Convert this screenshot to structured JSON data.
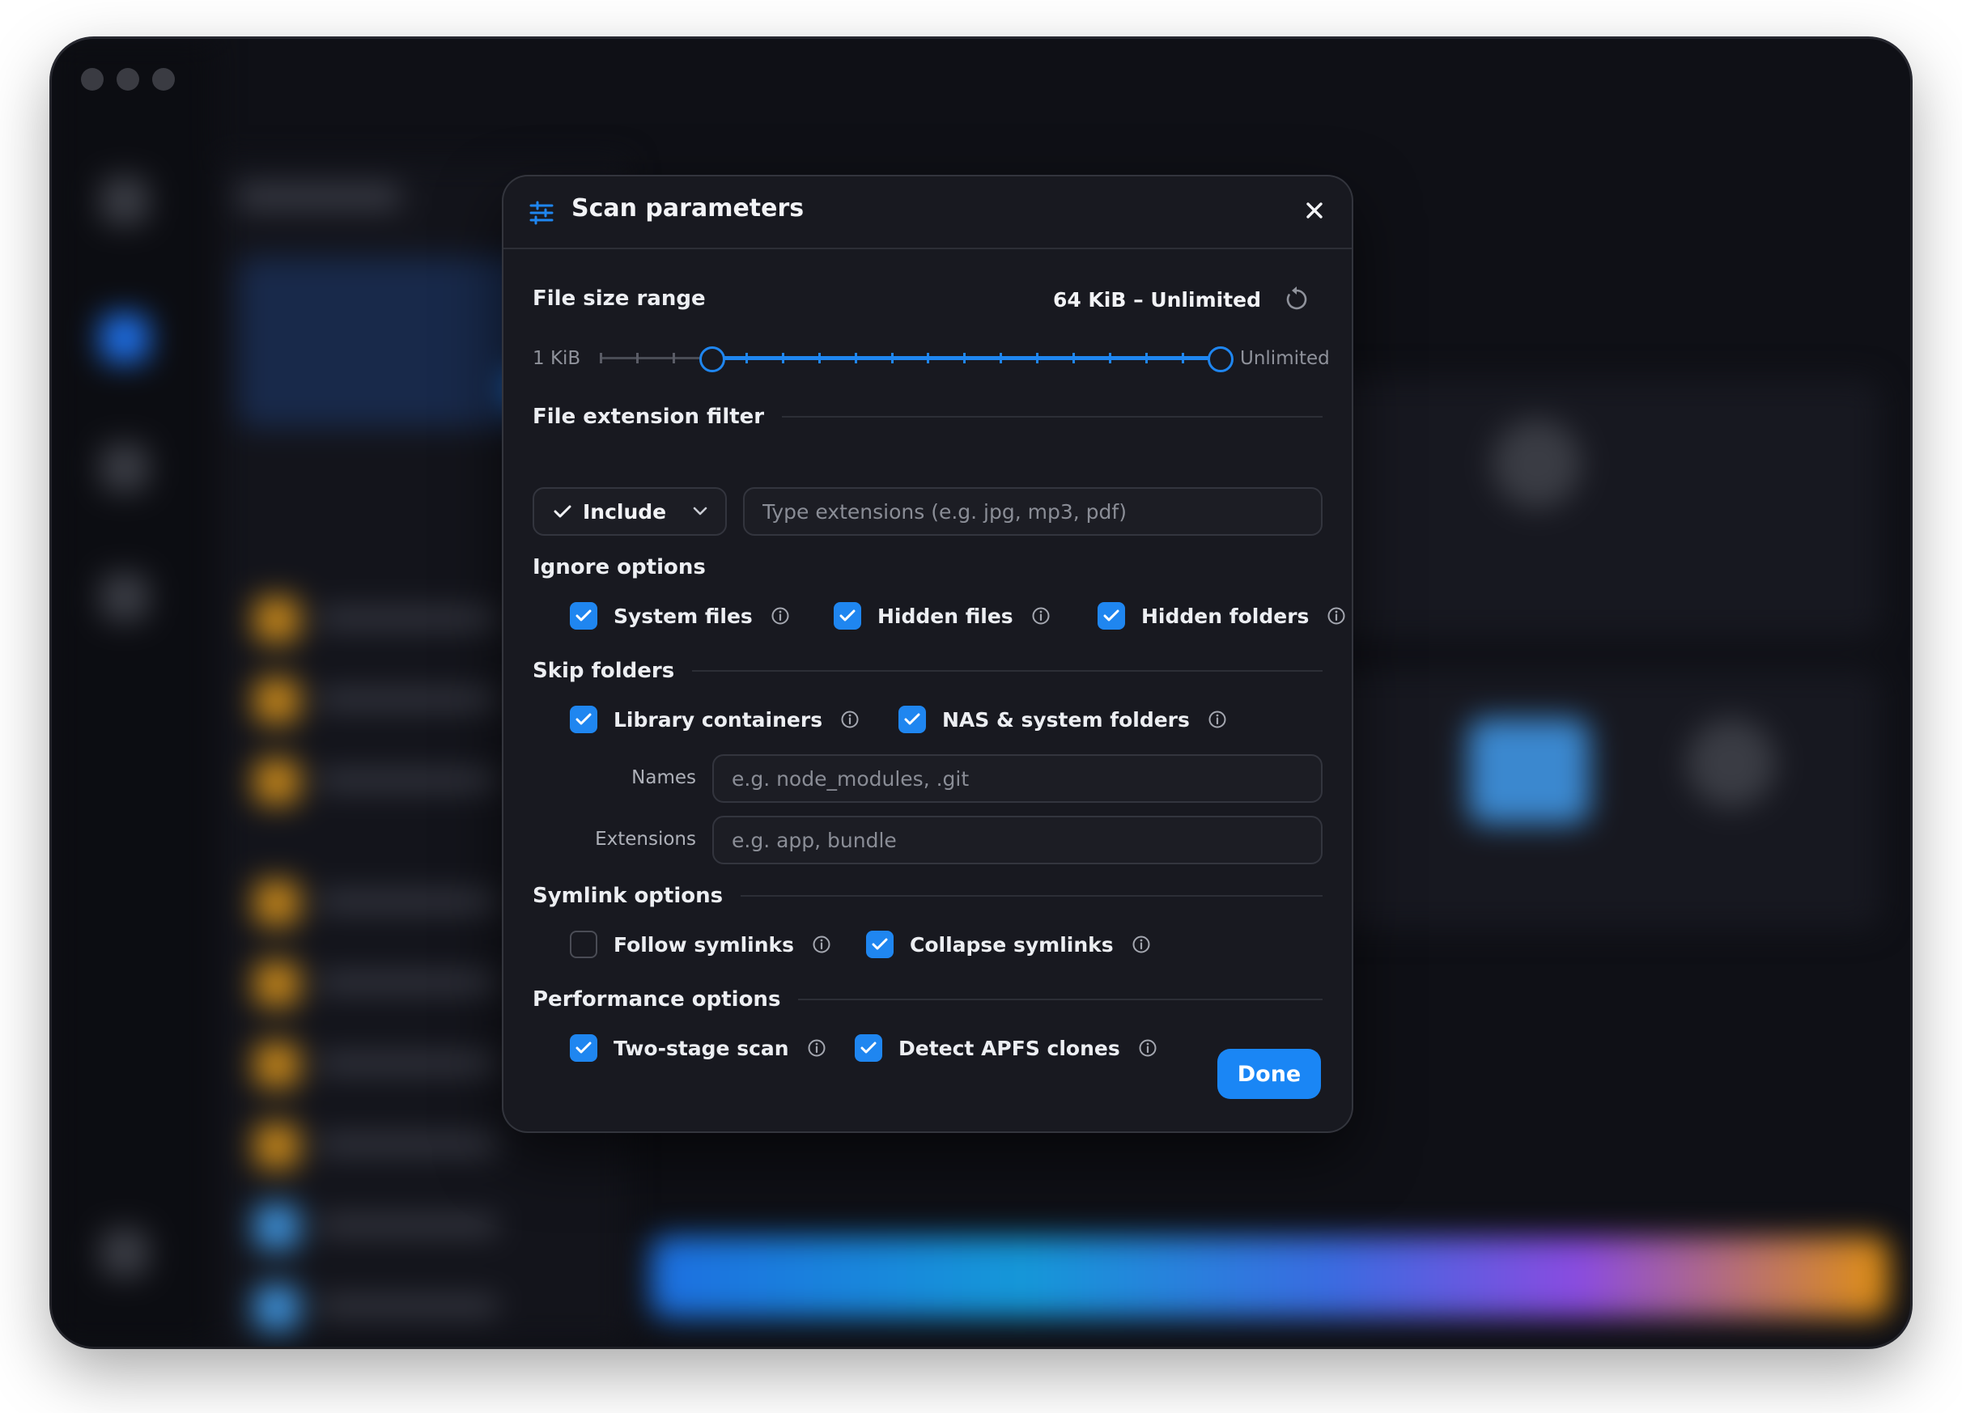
{
  "window": {
    "title": "Scan parameters",
    "header_icon": "sliders-icon"
  },
  "file_size": {
    "label": "File size range",
    "value": "64 KiB – Unlimited",
    "min_label": "1 KiB",
    "max_label": "Unlimited",
    "low_fraction": 0.18,
    "high_fraction": 1.0,
    "tick_count": 18
  },
  "extension_filter": {
    "label": "File extension filter",
    "mode": "Include",
    "placeholder": "Type extensions (e.g. jpg, mp3, pdf)"
  },
  "ignore_options": {
    "label": "Ignore options",
    "items": [
      {
        "label": "System files",
        "checked": true
      },
      {
        "label": "Hidden files",
        "checked": true
      },
      {
        "label": "Hidden folders",
        "checked": true
      }
    ]
  },
  "skip_folders": {
    "label": "Skip folders",
    "items": [
      {
        "label": "Library containers",
        "checked": true
      },
      {
        "label": "NAS & system folders",
        "checked": true
      }
    ],
    "names_label": "Names",
    "names_placeholder": "e.g. node_modules, .git",
    "extensions_label": "Extensions",
    "extensions_placeholder": "e.g. app, bundle"
  },
  "symlink_options": {
    "label": "Symlink options",
    "items": [
      {
        "label": "Follow symlinks",
        "checked": false
      },
      {
        "label": "Collapse symlinks",
        "checked": true
      }
    ]
  },
  "performance_options": {
    "label": "Performance options",
    "items": [
      {
        "label": "Two-stage scan",
        "checked": true
      },
      {
        "label": "Detect APFS clones",
        "checked": true
      }
    ]
  },
  "done_label": "Done",
  "colors": {
    "accent": "#1f86f0",
    "modal_bg": "#181920",
    "window_bg": "#0f1016"
  }
}
